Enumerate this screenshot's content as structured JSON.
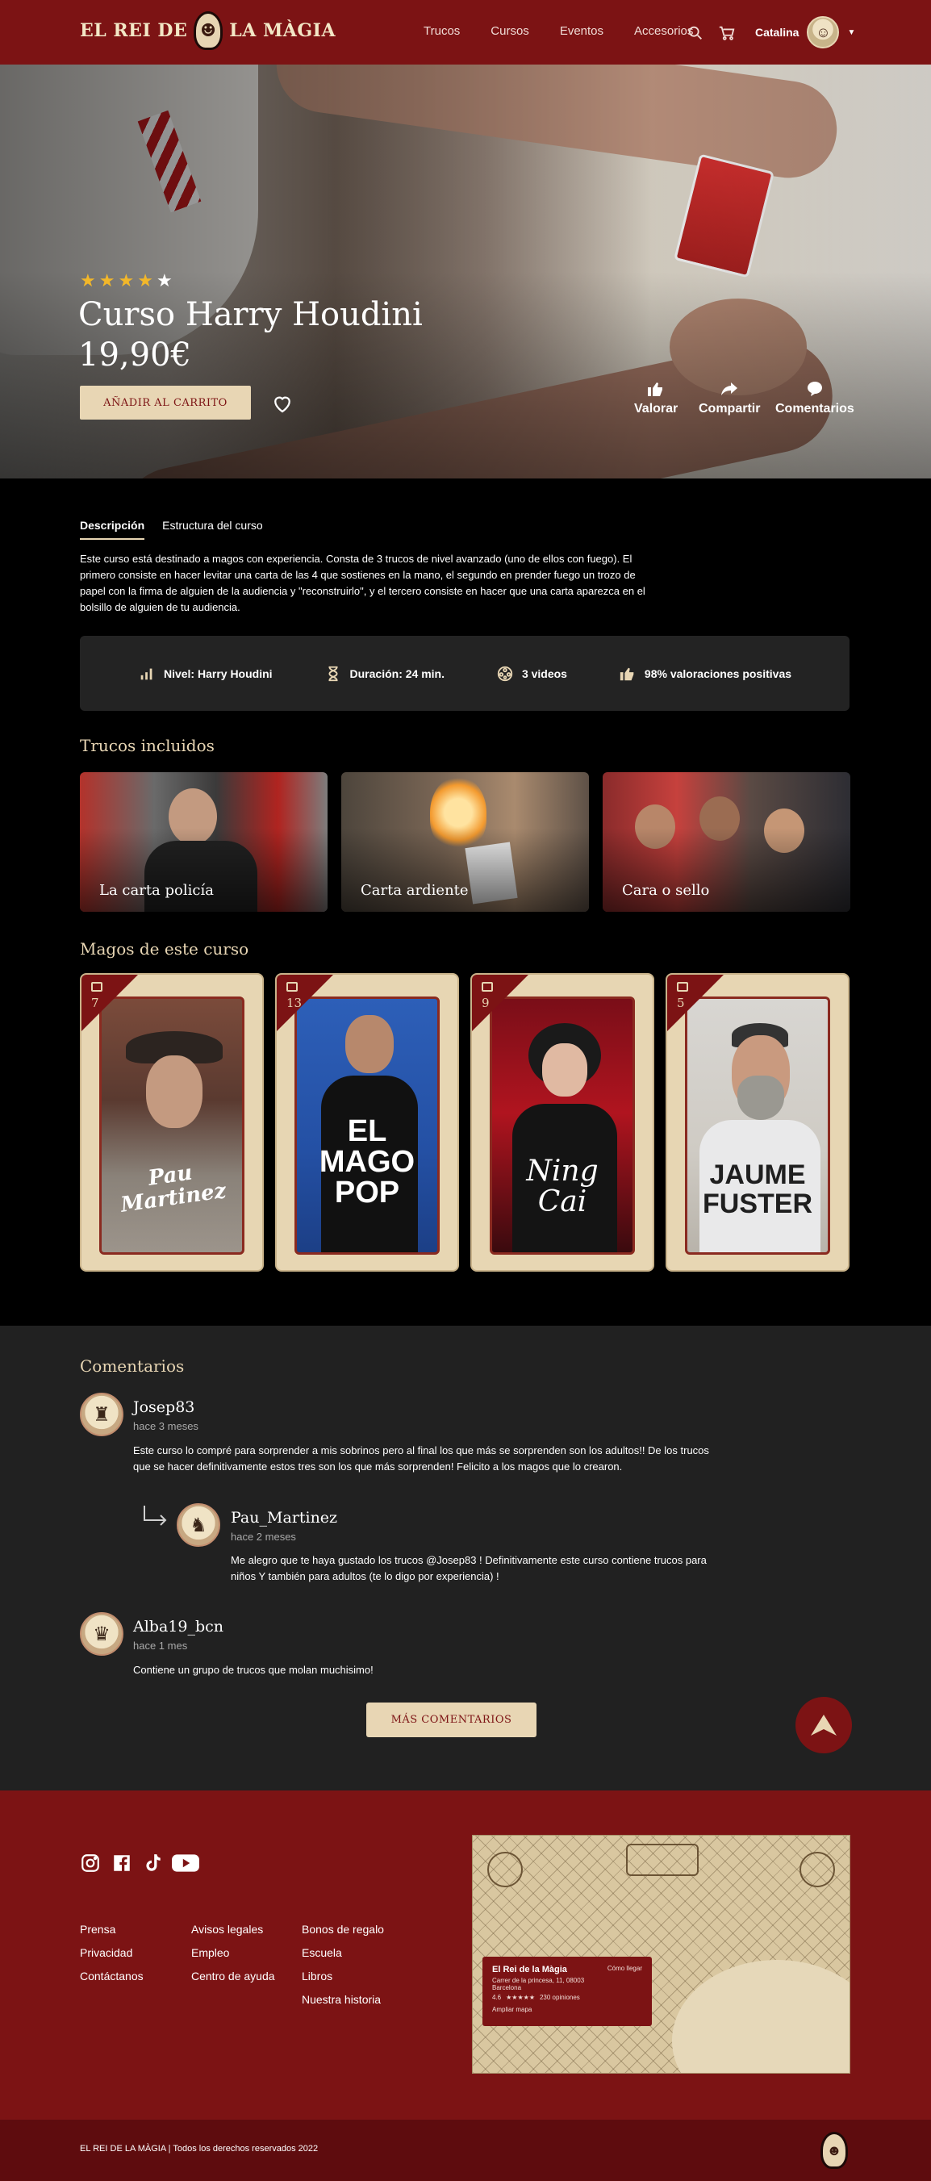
{
  "header": {
    "logo_left": "EL REI DE",
    "logo_right": "LA MÀGIA",
    "nav": [
      "Trucos",
      "Cursos",
      "Eventos",
      "Accesorios"
    ],
    "user_name": "Catalina"
  },
  "hero": {
    "rating": 4,
    "rating_max": 5,
    "title": "Curso Harry Houdini",
    "price": "19,90€",
    "cart_button": "AÑADIR AL CARRITO",
    "actions": [
      "Valorar",
      "Compartir",
      "Comentarios"
    ]
  },
  "tabs": [
    "Descripción",
    "Estructura del curso"
  ],
  "description": "Este curso está destinado a magos con  experiencia. Consta de 3 trucos de nivel avanzado (uno de ellos con fuego). El primero consiste en hacer levitar una carta de las 4 que sostienes en la mano, el segundo en prender fuego un trozo de papel con la firma de alguien de la audiencia y \"reconstruirlo\", y el tercero consiste en hacer que una carta aparezca en el bolsillo de alguien de tu audiencia.",
  "stats": {
    "level": "Nivel: Harry Houdini",
    "duration": "Duración: 24 min.",
    "videos": "3 videos",
    "rating": "98% valoraciones positivas"
  },
  "tricks": {
    "title": "Trucos incluidos",
    "items": [
      "La carta policía",
      "Carta ardiente",
      "Cara o sello"
    ]
  },
  "magicians": {
    "title": "Magos de este curso",
    "items": [
      {
        "name_line1": "Pau",
        "name_line2": "Martinez",
        "count": "7"
      },
      {
        "name_line1": "EL MAGO",
        "name_line2": "POP",
        "count": "13"
      },
      {
        "name_line1": "Ning",
        "name_line2": "Cai",
        "count": "9"
      },
      {
        "name_line1": "JAUME",
        "name_line2": "FUSTER",
        "count": "5"
      }
    ]
  },
  "comments": {
    "title": "Comentarios",
    "items": [
      {
        "user": "Josep83",
        "time": "hace 3 meses",
        "text": "Este curso lo compré para sorprender a mis sobrinos pero al final los que más se sorprenden son los adultos!! De los trucos que se hacer definitivamente estos tres son los que más sorprenden! Felicito a los magos que lo crearon."
      },
      {
        "user": "Pau_Martinez",
        "time": "hace 2 meses",
        "text": "Me alegro que te haya gustado los trucos @Josep83 ! Definitivamente este curso contiene trucos para niños Y también para adultos (te lo digo por experiencia) !"
      },
      {
        "user": "Alba19_bcn",
        "time": "hace 1 mes",
        "text": "Contiene un grupo de trucos que molan muchisimo!"
      }
    ],
    "more_button": "MÁS COMENTARIOS"
  },
  "footer": {
    "col1": [
      "Prensa",
      "Privacidad",
      "Contáctanos"
    ],
    "col2": [
      "Avisos legales",
      "Empleo",
      "Centro de ayuda"
    ],
    "col3": [
      "Bonos de regalo",
      "Escuela",
      "Libros",
      "Nuestra historia"
    ],
    "map": {
      "name": "El Rei de la Màgia",
      "directions": "Cómo llegar",
      "address": "Carrer de la princesa, 11, 08003",
      "city": "Barcelona",
      "rating": "4.6",
      "stars": "★★★★★",
      "reviews": "230 opiniones",
      "enlarge": "Ampliar mapa"
    },
    "copyright": "EL REI DE LA MÀGIA | Todos los derechos reservados 2022"
  },
  "colors": {
    "brand": "#7c1314",
    "cream": "#e8d6b4",
    "dark_panel": "#212121",
    "star": "#f2b72a"
  }
}
